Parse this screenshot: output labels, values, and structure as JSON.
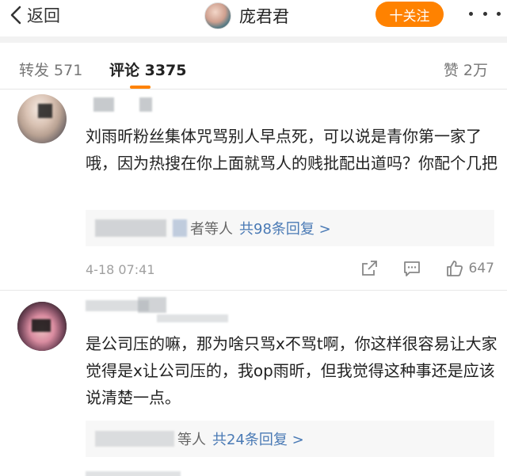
{
  "header": {
    "back_label": "返回",
    "title": "庞君君",
    "follow_label": "十关注",
    "colors": {
      "accent": "#ff8200",
      "link": "#4a7ab5"
    }
  },
  "tabs": {
    "repost": "转发 571",
    "comment": "评论 3375",
    "like": "赞 2万"
  },
  "comments": [
    {
      "text": "刘雨昕粉丝集体咒骂别人早点死，可以说是青你第一家了哦，因为热搜在你上面就骂人的贱批配出道吗？你配个几把",
      "reply_prefix": "者等人",
      "reply_link": "共98条回复 >",
      "time": "4-18 07:41",
      "likes": "647"
    },
    {
      "text": "是公司压的嘛，那为啥只骂x不骂t啊，你这样很容易让大家觉得是x让公司压的，我op雨昕，但我觉得这种事还是应该说清楚一点。",
      "reply_prefix": "等人",
      "reply_link": "共24条回复 >"
    }
  ]
}
